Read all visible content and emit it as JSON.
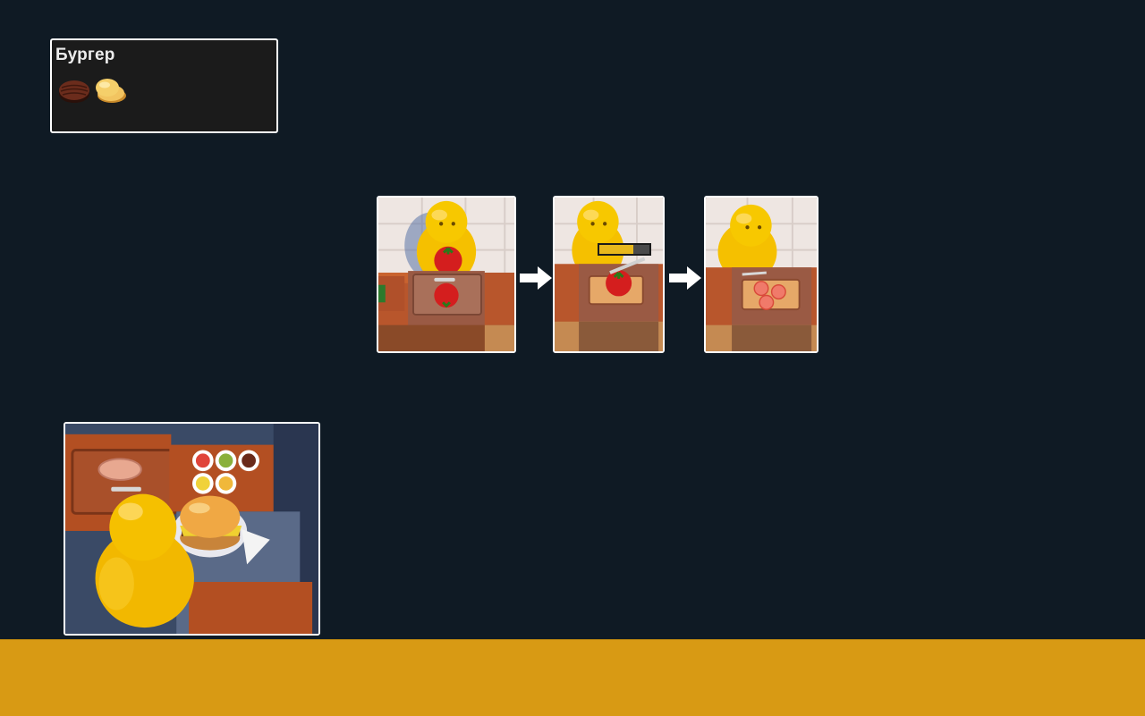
{
  "recipe": {
    "title": "Бургер",
    "ingredients": [
      {
        "icon": "patty-icon"
      },
      {
        "icon": "bun-icon"
      }
    ]
  },
  "tutorial": {
    "steps": [
      {
        "name": "pick-up-tomato"
      },
      {
        "name": "chop-tomato",
        "progress": 0.68
      },
      {
        "name": "sliced-tomato"
      }
    ],
    "arrows": [
      "arrow-right-icon",
      "arrow-right-icon"
    ]
  },
  "colors": {
    "background": "#0f1a24",
    "bottom_bar": "#d89a14",
    "card_border": "#ffffff",
    "progress_fill": "#e8b81c",
    "character": "#f5c000"
  }
}
